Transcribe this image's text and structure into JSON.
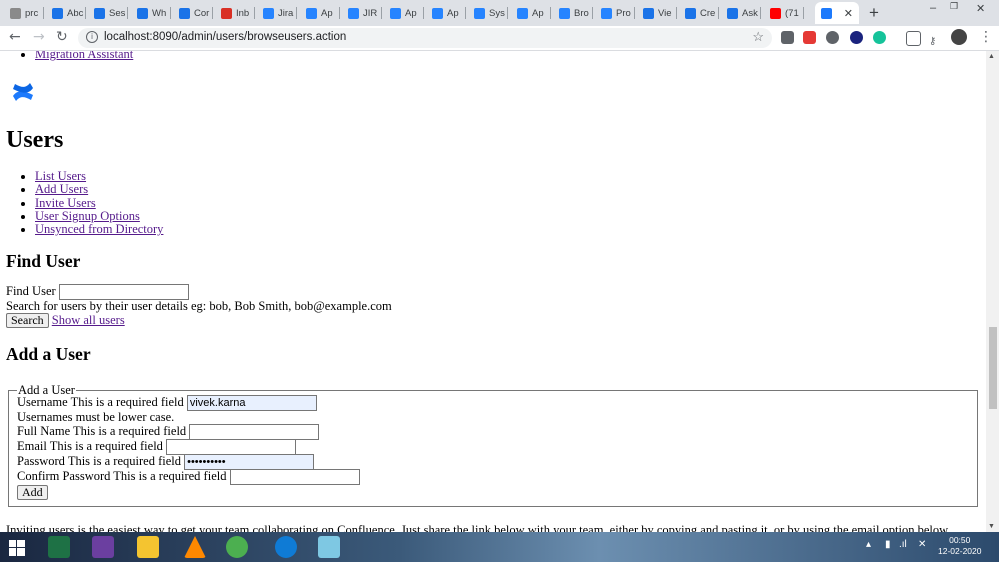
{
  "browser": {
    "tabs": [
      {
        "label": "prc",
        "color": "#8a8a8a"
      },
      {
        "label": "Abc",
        "color": "#1a73e8"
      },
      {
        "label": "Ses",
        "color": "#1a73e8"
      },
      {
        "label": "Wh",
        "color": "#1a73e8"
      },
      {
        "label": "Cor",
        "color": "#1a73e8"
      },
      {
        "label": "Inb",
        "color": "#d93025"
      },
      {
        "label": "Jira",
        "color": "#2684ff"
      },
      {
        "label": "Ap",
        "color": "#2684ff"
      },
      {
        "label": "JIR",
        "color": "#2684ff"
      },
      {
        "label": "Ap",
        "color": "#2684ff"
      },
      {
        "label": "Ap",
        "color": "#2684ff"
      },
      {
        "label": "Sys",
        "color": "#2684ff"
      },
      {
        "label": "Ap",
        "color": "#2684ff"
      },
      {
        "label": "Bro",
        "color": "#2684ff"
      },
      {
        "label": "Pro",
        "color": "#2684ff"
      },
      {
        "label": "Vie",
        "color": "#1a73e8"
      },
      {
        "label": "Cre",
        "color": "#1a73e8"
      },
      {
        "label": "Ask",
        "color": "#1a73e8"
      },
      {
        "label": "(71",
        "color": "#ff0000"
      }
    ],
    "active_tab_close": "✕",
    "new_tab": "+",
    "url": "localhost:8090/admin/users/browseusers.action"
  },
  "page": {
    "top_link": "Migration Assistant",
    "heading": "Users",
    "nav_links": [
      "List Users",
      "Add Users",
      "Invite Users",
      "User Signup Options",
      "Unsynced from Directory"
    ],
    "find_user": {
      "heading": "Find User",
      "label": "Find User",
      "value": "",
      "help": "Search for users by their user details eg: bob, Bob Smith, bob@example.com",
      "search_button": "Search",
      "show_all_link": "Show all users"
    },
    "add_user": {
      "heading": "Add a User",
      "legend": "Add a User",
      "username_label": "Username This is a required field",
      "username_value": "vivek.karna",
      "username_hint": "Usernames must be lower case.",
      "fullname_label": "Full Name This is a required field",
      "fullname_value": "",
      "email_label": "Email This is a required field",
      "email_value": "",
      "password_label": "Password This is a required field",
      "password_value": "••••••••••",
      "confirm_label": "Confirm Password This is a required field",
      "confirm_value": "",
      "add_button": "Add"
    },
    "invite_text": "Inviting users is the easiest way to get your team collaborating on Confluence. Just share the link below with your team, either by copying and pasting it, or by using the email option below."
  },
  "taskbar": {
    "time": "00:50",
    "date": "12-02-2020"
  }
}
